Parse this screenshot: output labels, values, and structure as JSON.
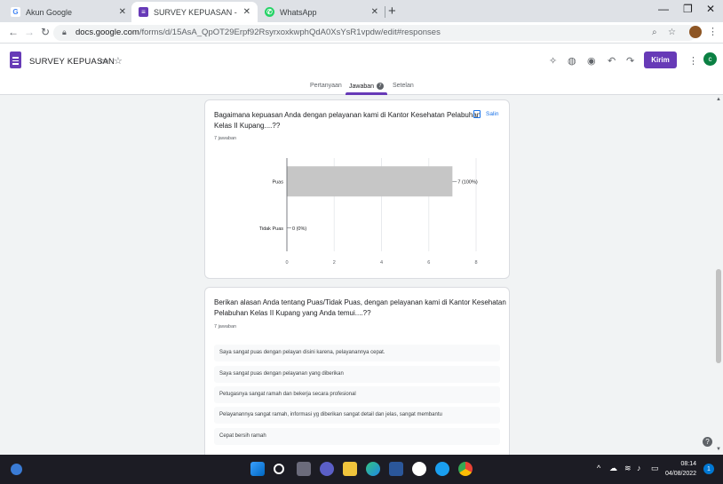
{
  "browser": {
    "tabs": [
      {
        "title": "Akun Google",
        "icon": "google-icon",
        "color": "#4285f4"
      },
      {
        "title": "SURVEY KEPUASAN - Google Fo",
        "icon": "forms-icon",
        "color": "#673ab7",
        "active": true
      },
      {
        "title": "WhatsApp",
        "icon": "whatsapp-icon",
        "color": "#25d366"
      }
    ],
    "new_tab": "+",
    "url_host": "docs.google.com",
    "url_path": "/forms/d/15AsA_QpOT29Erpf92RsyrxoxkwphQdA0XsYsR1vpdw/edit#responses"
  },
  "forms": {
    "title": "SURVEY KEPUASAN",
    "send_label": "Kirim",
    "user_initial": "c",
    "accent": "#673ab7",
    "tabs": [
      {
        "label": "Pertanyaan"
      },
      {
        "label": "Jawaban",
        "badge": "7",
        "active": true
      },
      {
        "label": "Setelan"
      }
    ]
  },
  "question1": {
    "text_line1": "Bagaimana kepuasan Anda dengan pelayanan kami di Kantor Kesehatan Pelabuhan",
    "text_line2": "Kelas II Kupang....??",
    "count": "7 jawaban",
    "copy_label": "Salin"
  },
  "chart_data": {
    "type": "bar",
    "orientation": "horizontal",
    "categories": [
      "Puas",
      "Tidak Puas"
    ],
    "values": [
      7,
      0
    ],
    "data_labels": [
      "7 (100%)",
      "0 (0%)"
    ],
    "xlim": [
      0,
      8
    ],
    "xticks": [
      "0",
      "2",
      "4",
      "6",
      "8"
    ],
    "bar_color": "#c6c6c6",
    "grid": true
  },
  "question2": {
    "text_line1": "Berikan alasan Anda tentang Puas/Tidak Puas, dengan pelayanan kami di Kantor Kesehatan",
    "text_line2": "Pelabuhan Kelas II Kupang yang Anda temui....??",
    "count": "7 jawaban",
    "answers": [
      "Saya sangat puas dengan pelayan disini karena, pelayanannya cepat.",
      "Saya sangat puas dengan pelayanan yang diberikan",
      "Petugasnya sangat ramah dan bekerja secara profesional",
      "Pelayanannya sangat ramah, informasi yg diberikan sangat detail dan jelas, sangat membantu",
      "Cepat bersih ramah"
    ]
  },
  "taskbar": {
    "time": "08:14",
    "date": "04/08/2022",
    "notifications": "1"
  }
}
